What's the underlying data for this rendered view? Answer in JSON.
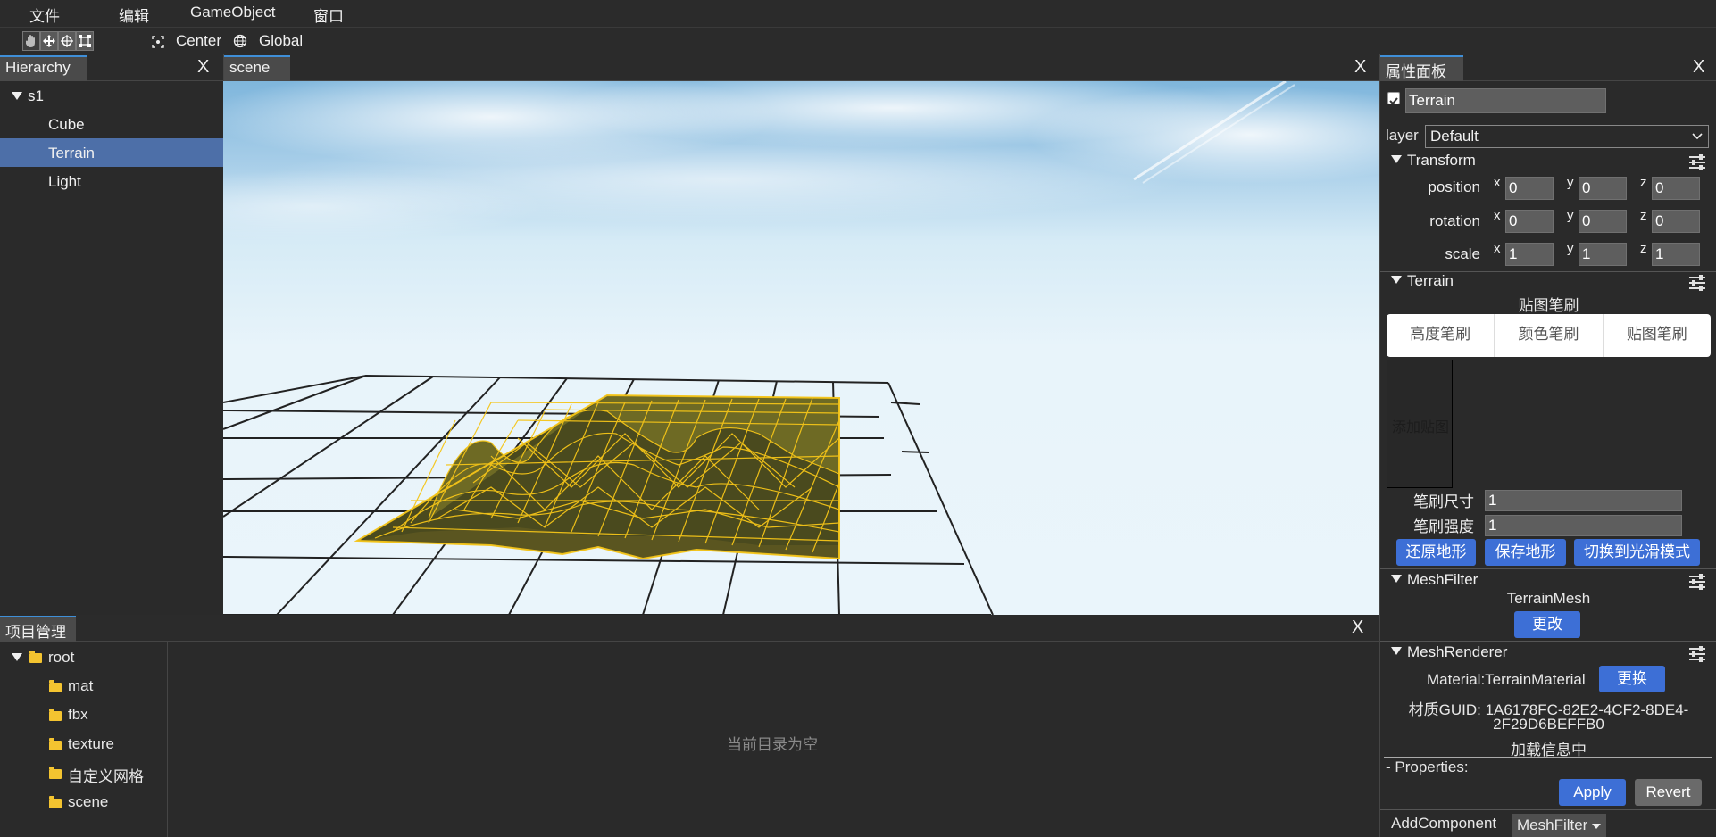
{
  "menu": [
    "文件",
    "编辑",
    "GameObject",
    "窗口"
  ],
  "toolbar": {
    "pivot_label": "Center",
    "space_label": "Global",
    "tools": [
      "hand-icon",
      "move-icon",
      "rotate-icon",
      "scale-icon"
    ]
  },
  "hierarchy": {
    "tab": "Hierarchy",
    "close": "X",
    "root": "s1",
    "items": [
      "Cube",
      "Terrain",
      "Light"
    ],
    "selected": "Terrain"
  },
  "scene": {
    "tab": "scene",
    "close": "X"
  },
  "project": {
    "tab": "项目管理",
    "close": "X",
    "root": "root",
    "folders": [
      "mat",
      "fbx",
      "texture",
      "自定义网格",
      "scene"
    ],
    "empty_text": "当前目录为空"
  },
  "inspector": {
    "tab": "属性面板",
    "close": "X",
    "object_name": "Terrain",
    "enabled": true,
    "layer_label": "layer",
    "layer_value": "Default",
    "transform": {
      "title": "Transform",
      "position_label": "position",
      "rotation_label": "rotation",
      "scale_label": "scale",
      "x_label": "x",
      "y_label": "y",
      "z_label": "z",
      "position": [
        "0",
        "0",
        "0"
      ],
      "rotation": [
        "0",
        "0",
        "0"
      ],
      "scale": [
        "1",
        "1",
        "1"
      ]
    },
    "terrain": {
      "title": "Terrain",
      "current_brush": "贴图笔刷",
      "brush_tabs": [
        "高度笔刷",
        "颜色笔刷",
        "贴图笔刷"
      ],
      "add_texture": "添加贴图",
      "brush_size_label": "笔刷尺寸",
      "brush_size": "1",
      "brush_strength_label": "笔刷强度",
      "brush_strength": "1",
      "buttons": [
        "还原地形",
        "保存地形",
        "切换到光滑模式"
      ]
    },
    "meshfilter": {
      "title": "MeshFilter",
      "mesh": "TerrainMesh",
      "change_button": "更改"
    },
    "meshrenderer": {
      "title": "MeshRenderer",
      "material": "Material:TerrainMaterial",
      "replace_button": "更换",
      "guid_line1": "材质GUID: 1A6178FC-82E2-4CF2-8DE4-",
      "guid_line2": "2F29D6BEFFB0",
      "loading": "加载信息中",
      "properties": "- Properties:",
      "apply": "Apply",
      "revert": "Revert"
    },
    "add_component_label": "AddComponent",
    "add_component_value": "MeshFilter"
  },
  "colors": {
    "accent": "#3f8fd8",
    "selection": "#4d6fa8",
    "button": "#3d6fd6",
    "mesh": "#f5c518",
    "panel": "#2a2a2a"
  }
}
